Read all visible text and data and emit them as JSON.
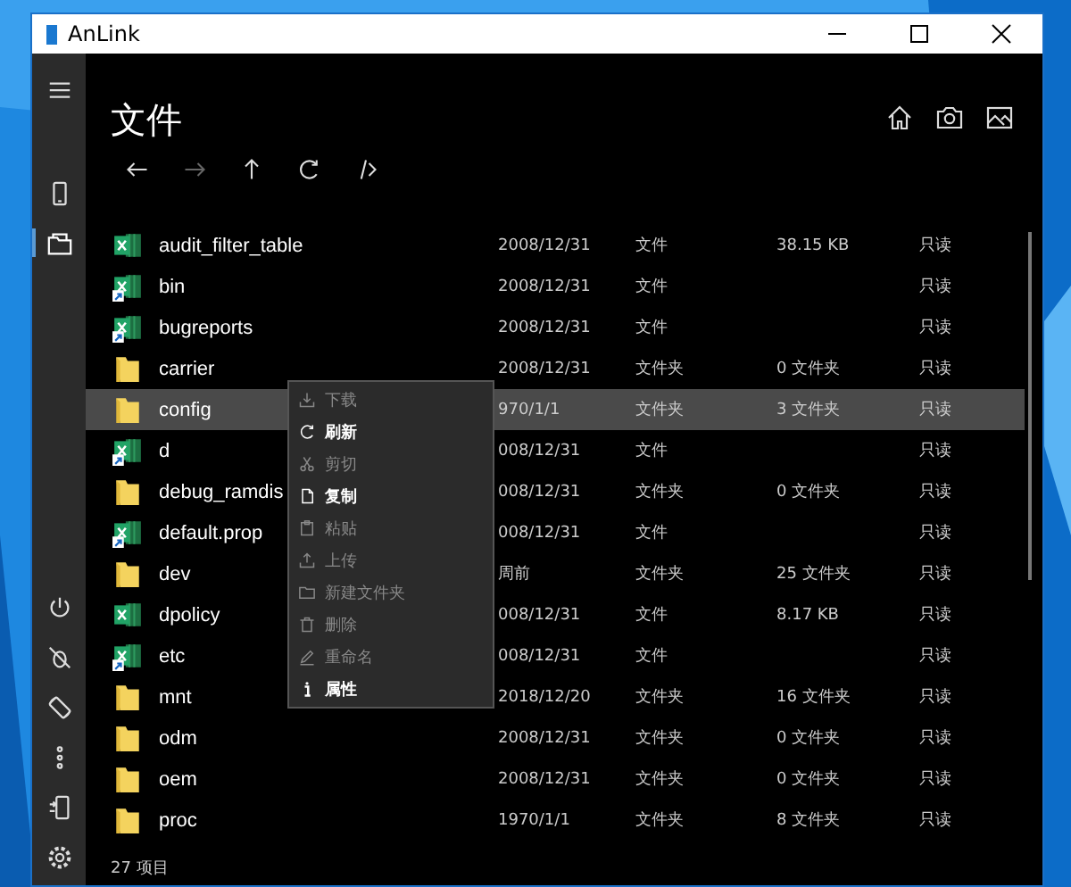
{
  "window": {
    "title": "AnLink"
  },
  "sidebar": {
    "items": [
      {
        "kind": "menu",
        "selected": false
      },
      {
        "kind": "phone",
        "selected": false
      },
      {
        "kind": "files",
        "selected": true
      },
      {
        "kind": "power",
        "selected": false
      },
      {
        "kind": "debug",
        "selected": false
      },
      {
        "kind": "rotate",
        "selected": false
      },
      {
        "kind": "more",
        "selected": false
      },
      {
        "kind": "sync",
        "selected": false
      },
      {
        "kind": "settings",
        "selected": false
      }
    ]
  },
  "page_title": "文件",
  "nav": [
    {
      "kind": "back",
      "disabled": false
    },
    {
      "kind": "forward",
      "disabled": true
    },
    {
      "kind": "up",
      "disabled": false
    },
    {
      "kind": "refresh",
      "disabled": false
    },
    {
      "kind": "path",
      "disabled": false
    }
  ],
  "files": [
    {
      "kind": "file",
      "name": "audit_filter_table",
      "date": "2008/12/31",
      "type": "文件",
      "size": "38.15 KB",
      "attr": "只读",
      "selected": false
    },
    {
      "kind": "link",
      "name": "bin",
      "date": "2008/12/31",
      "type": "文件",
      "attr": "只读",
      "selected": false
    },
    {
      "kind": "link",
      "name": "bugreports",
      "date": "2008/12/31",
      "type": "文件",
      "attr": "只读",
      "selected": false
    },
    {
      "kind": "folder",
      "name": "carrier",
      "date": "2008/12/31",
      "type": "文件夹",
      "size": "0 文件夹",
      "attr": "只读",
      "selected": false
    },
    {
      "kind": "folder",
      "name": "config",
      "date": "970/1/1",
      "type": "文件夹",
      "size": "3 文件夹",
      "attr": "只读",
      "selected": true
    },
    {
      "kind": "link",
      "name": "d",
      "date": "008/12/31",
      "type": "文件",
      "attr": "只读",
      "selected": false
    },
    {
      "kind": "folder",
      "name": "debug_ramdis",
      "date": "008/12/31",
      "type": "文件夹",
      "size": "0 文件夹",
      "attr": "只读",
      "selected": false
    },
    {
      "kind": "link",
      "name": "default.prop",
      "date": "008/12/31",
      "type": "文件",
      "attr": "只读",
      "selected": false
    },
    {
      "kind": "folder",
      "name": "dev",
      "date": "周前",
      "type": "文件夹",
      "size": "25 文件夹",
      "attr": "只读",
      "selected": false
    },
    {
      "kind": "file",
      "name": "dpolicy",
      "date": "008/12/31",
      "type": "文件",
      "size": "8.17 KB",
      "attr": "只读",
      "selected": false
    },
    {
      "kind": "link",
      "name": "etc",
      "date": "008/12/31",
      "type": "文件",
      "attr": "只读",
      "selected": false
    },
    {
      "kind": "folder",
      "name": "mnt",
      "date": "2018/12/20",
      "type": "文件夹",
      "size": "16 文件夹",
      "attr": "只读",
      "selected": false
    },
    {
      "kind": "folder",
      "name": "odm",
      "date": "2008/12/31",
      "type": "文件夹",
      "size": "0 文件夹",
      "attr": "只读",
      "selected": false
    },
    {
      "kind": "folder",
      "name": "oem",
      "date": "2008/12/31",
      "type": "文件夹",
      "size": "0 文件夹",
      "attr": "只读",
      "selected": false
    },
    {
      "kind": "folder",
      "name": "proc",
      "date": "1970/1/1",
      "type": "文件夹",
      "size": "8 文件夹",
      "attr": "只读",
      "selected": false
    }
  ],
  "status_bar": "27 项目",
  "context_menu": [
    {
      "kind": "download",
      "label": "下载",
      "disabled": true
    },
    {
      "kind": "refresh",
      "label": "刷新",
      "disabled": false
    },
    {
      "kind": "cut",
      "label": "剪切",
      "disabled": true
    },
    {
      "kind": "copy",
      "label": "复制",
      "disabled": false
    },
    {
      "kind": "paste",
      "label": "粘贴",
      "disabled": true
    },
    {
      "kind": "upload",
      "label": "上传",
      "disabled": true
    },
    {
      "kind": "folder",
      "label": "新建文件夹",
      "disabled": true
    },
    {
      "kind": "delete",
      "label": "删除",
      "disabled": true
    },
    {
      "kind": "rename",
      "label": "重命名",
      "disabled": true
    },
    {
      "kind": "info",
      "label": "属性",
      "disabled": false
    }
  ]
}
